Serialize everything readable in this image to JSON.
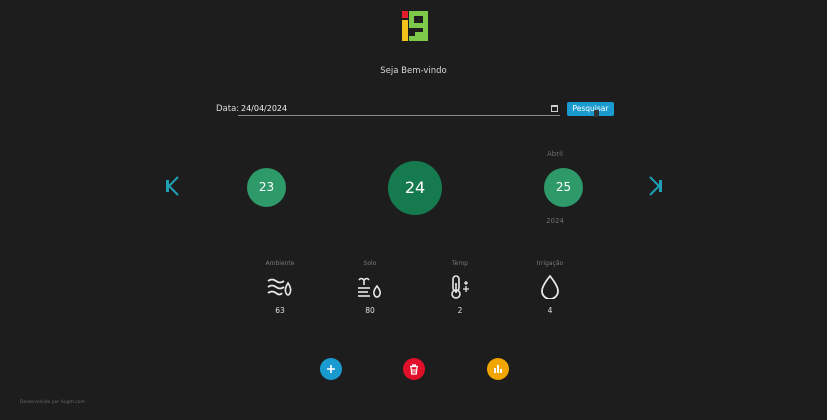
{
  "header": {
    "logo_alt": "i9",
    "welcome": "Seja Bem-vindo"
  },
  "search": {
    "date_label": "Data:",
    "date_value": "24/04/2024",
    "button_label": "Pesquisar"
  },
  "calendar": {
    "prev_day": "23",
    "current_day": "24",
    "next_day": "25",
    "month": "Abril",
    "year": "2024"
  },
  "metrics": [
    {
      "label": "Ambiente",
      "icon": "wind-water-icon",
      "value": "63"
    },
    {
      "label": "Solo",
      "icon": "soil-drop-icon",
      "value": "80"
    },
    {
      "label": "Temp",
      "icon": "thermometer-icon",
      "value": "2"
    },
    {
      "label": "Irrigação",
      "icon": "water-drop-icon",
      "value": "4"
    }
  ],
  "actions": {
    "add_color": "#1a9bd0",
    "delete_color": "#e0102a",
    "chart_color": "#f0a500"
  },
  "footer": {
    "text": "Desenvolvido por Augm.com"
  },
  "colors": {
    "background": "#1d1d1d",
    "day_circle": "#2f9a69",
    "day_circle_current": "#167a4f",
    "arrow": "#1fa0b5"
  }
}
